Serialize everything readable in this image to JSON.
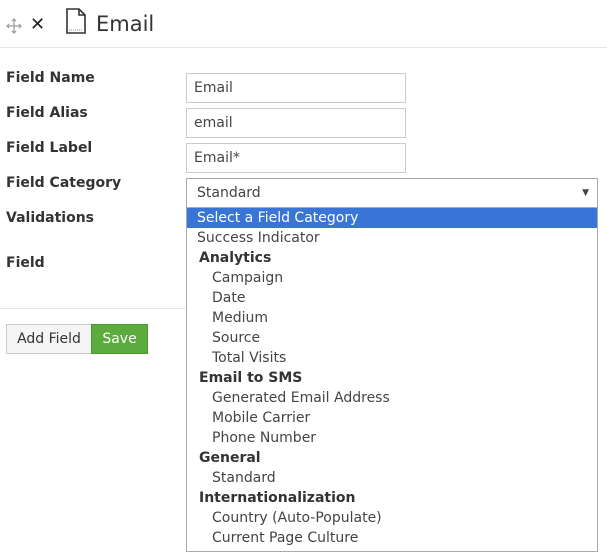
{
  "header": {
    "title": "Email"
  },
  "form": {
    "field_name": {
      "label": "Field Name",
      "value": "Email"
    },
    "field_alias": {
      "label": "Field Alias",
      "value": "email"
    },
    "field_label": {
      "label": "Field Label",
      "value": "Email*"
    },
    "field_category": {
      "label": "Field Category",
      "selected": "Standard"
    },
    "validations_label": "Validations",
    "field_label_short": "Field"
  },
  "buttons": {
    "add_field": "Add Field",
    "save": "Save"
  },
  "dropdown": {
    "highlighted": "Select a Field Category",
    "ungrouped": [
      "Success Indicator"
    ],
    "groups": [
      {
        "name": "Analytics",
        "items": [
          "Campaign",
          "Date",
          "Medium",
          "Source",
          "Total Visits"
        ]
      },
      {
        "name": "Email to SMS",
        "items": [
          "Generated Email Address",
          "Mobile Carrier",
          "Phone Number"
        ]
      },
      {
        "name": "General",
        "items": [
          "Standard"
        ]
      },
      {
        "name": "Internationalization",
        "items": [
          "Country (Auto-Populate)",
          "Current Page Culture"
        ]
      }
    ]
  },
  "colors": {
    "highlight": "#3875d7",
    "save_button": "#5cab3f"
  }
}
